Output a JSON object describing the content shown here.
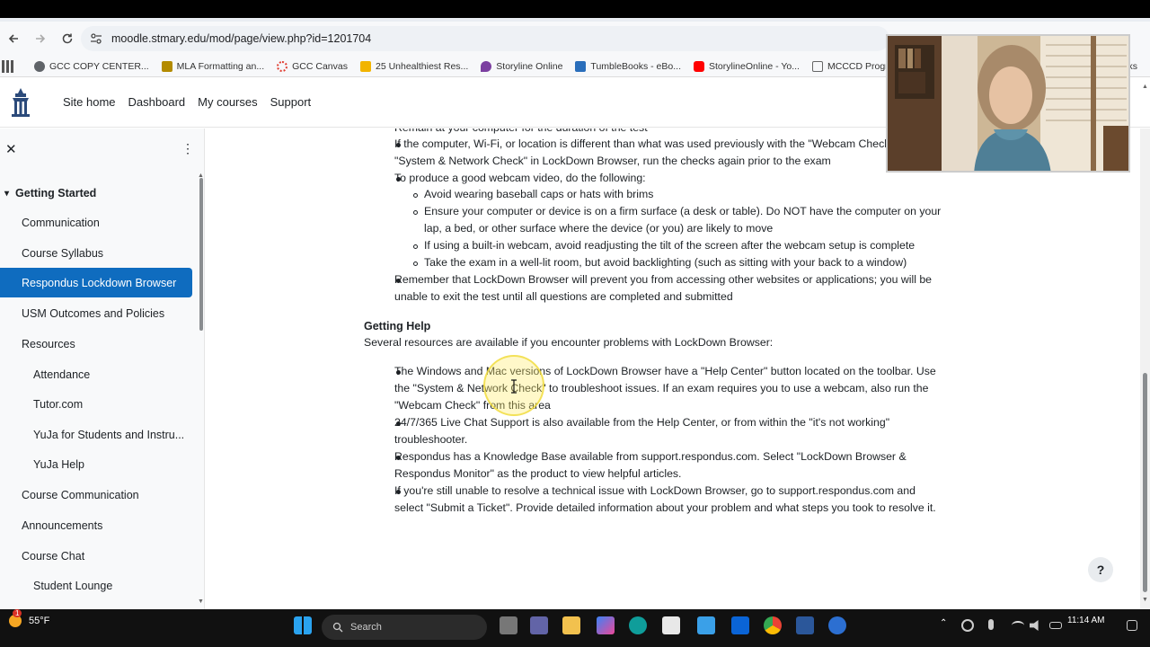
{
  "browser": {
    "url": "moodle.stmary.edu/mod/page/view.php?id=1201704",
    "bookmarks": [
      {
        "label": "GCC COPY CENTER...",
        "color": "#5f6368"
      },
      {
        "label": "MLA Formatting an...",
        "color": "#b38b00"
      },
      {
        "label": "GCC Canvas",
        "color": "#e03c31"
      },
      {
        "label": "25 Unhealthiest Res...",
        "color": "#f2b400"
      },
      {
        "label": "Storyline Online",
        "color": "#7b3fa0"
      },
      {
        "label": "TumbleBooks - eBo...",
        "color": "#2a6ebb"
      },
      {
        "label": "StorylineOnline - Yo...",
        "color": "#ff0000"
      },
      {
        "label": "MCCCD Program D...",
        "color": "#666666"
      }
    ],
    "bookmark_overflow": "rks"
  },
  "moodle_nav": {
    "links": [
      "Site home",
      "Dashboard",
      "My courses",
      "Support"
    ]
  },
  "sidebar": {
    "section_title": "Getting Started",
    "items": [
      {
        "label": "Communication",
        "indent": false,
        "active": false
      },
      {
        "label": "Course Syllabus",
        "indent": false,
        "active": false
      },
      {
        "label": "Respondus Lockdown Browser",
        "indent": false,
        "active": true
      },
      {
        "label": "USM Outcomes and Policies",
        "indent": false,
        "active": false
      },
      {
        "label": "Resources",
        "indent": false,
        "active": false
      },
      {
        "label": "Attendance",
        "indent": true,
        "active": false
      },
      {
        "label": "Tutor.com",
        "indent": true,
        "active": false
      },
      {
        "label": "YuJa for Students and Instru...",
        "indent": true,
        "active": false
      },
      {
        "label": "YuJa Help",
        "indent": true,
        "active": false
      },
      {
        "label": "Course Communication",
        "indent": false,
        "active": false
      },
      {
        "label": "Announcements",
        "indent": false,
        "active": false
      },
      {
        "label": "Course Chat",
        "indent": false,
        "active": false
      },
      {
        "label": "Student Lounge",
        "indent": true,
        "active": false
      }
    ]
  },
  "content": {
    "cut_line": "Remain at your computer for the duration of the test",
    "line1a": "If the computer, Wi-Fi, or location is different than what was used previously with the \"Webcam Check\"",
    "line1b": "\"System & Network Check\" in LockDown Browser, run the checks again prior to the exam",
    "line2": "To produce a good webcam video, do the following:",
    "sub1": "Avoid wearing baseball caps or hats with brims",
    "sub2a": "Ensure your computer or device is on a firm surface (a desk or table). Do NOT have the computer on your",
    "sub2b": "lap, a bed, or other surface where the device (or you) are likely to move",
    "sub3": "If using a built-in webcam, avoid readjusting the tilt of the screen after the webcam setup is complete",
    "sub4": "Take the exam in a well-lit room, but avoid backlighting (such as sitting with your back to a window)",
    "line3a": "Remember that LockDown Browser will prevent you from accessing other websites or applications; you will be",
    "line3b": "unable to exit the test until all questions are completed and submitted",
    "help_heading": "Getting Help",
    "help_intro": "Several resources are available if you encounter problems with LockDown Browser:",
    "help1a": "The Windows and Mac versions of LockDown Browser have a \"Help Center\" button located on the toolbar. Use",
    "help1b": "the \"System & Network Check\" to troubleshoot issues. If an exam requires you to use a webcam, also run the",
    "help1c": "\"Webcam Check\" from this area",
    "help2a": "24/7/365 Live Chat Support is also available from the Help Center, or from within the \"it's not working\"",
    "help2b": "troubleshooter.",
    "help3a": "Respondus has a Knowledge Base available from support.respondus.com. Select \"LockDown Browser &",
    "help3b": "Respondus Monitor\" as the product to view helpful articles.",
    "help4a": "If you're still unable to resolve a technical issue with LockDown Browser, go to support.respondus.com and",
    "help4b": "select \"Submit a Ticket\". Provide detailed information about your problem and what steps you took to resolve it."
  },
  "help_button": "?",
  "taskbar": {
    "temperature": "55°F",
    "badge": "1",
    "search_placeholder": "Search",
    "time": "11:14 AM"
  },
  "colors": {
    "accent": "#0f6cbf",
    "text": "#1d2125"
  }
}
